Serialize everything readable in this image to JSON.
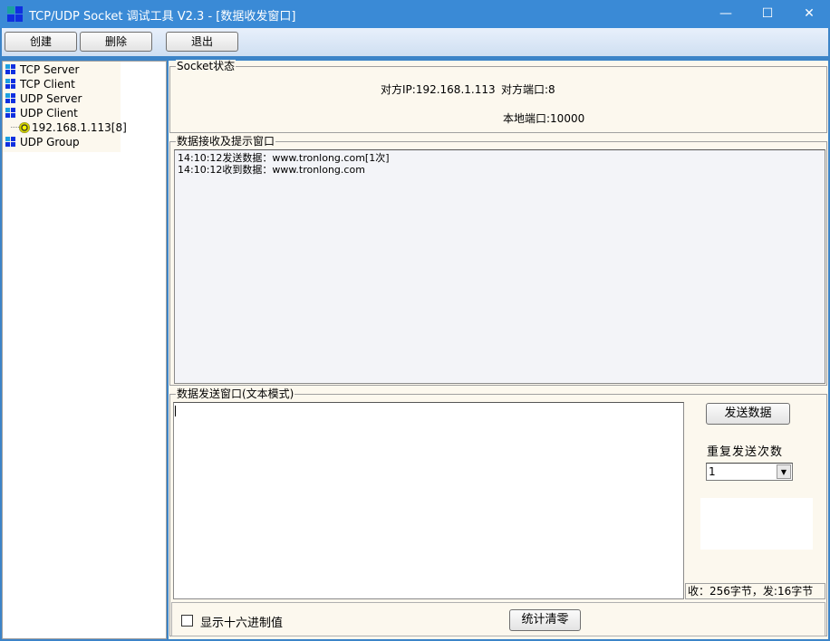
{
  "window": {
    "title": "TCP/UDP Socket 调试工具 V2.3  - [数据收发窗口]",
    "minimize": "—",
    "maximize": "☐",
    "close": "✕"
  },
  "toolbar": {
    "create": "创建",
    "delete": "删除",
    "exit": "退出"
  },
  "tree": {
    "items": [
      {
        "label": "TCP Server"
      },
      {
        "label": "TCP Client"
      },
      {
        "label": "UDP Server"
      },
      {
        "label": "UDP Client"
      },
      {
        "label": "192.168.1.113[8]"
      },
      {
        "label": "UDP Group"
      }
    ]
  },
  "socket_status": {
    "legend": "Socket状态",
    "remote_ip": "对方IP:192.168.1.113",
    "remote_port": "对方端口:8",
    "local_port": "本地端口:10000"
  },
  "receive": {
    "legend": "数据接收及提示窗口",
    "lines": [
      "14:10:12发送数据：www.tronlong.com[1次]",
      "14:10:12收到数据：www.tronlong.com"
    ]
  },
  "send": {
    "legend": "数据发送窗口(文本模式)",
    "value": "",
    "send_button": "发送数据",
    "repeat_label": "重复发送次数",
    "repeat_value": "1",
    "stats": "收：256字节，发:16字节"
  },
  "bottom": {
    "hex_label": "显示十六进制值",
    "hex_checked": false,
    "clear_button": "统计清零"
  }
}
